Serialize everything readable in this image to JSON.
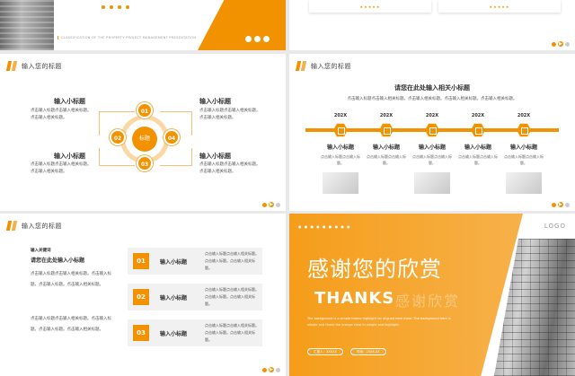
{
  "header_title": "输入您的标题",
  "slide1": {
    "subtitle": "CLASSIFICATION OF THE PROPERTY PROJECT MANAGEMENT PRESENTATION"
  },
  "slide3": {
    "center": "标题",
    "circles": [
      "01",
      "02",
      "03",
      "04"
    ],
    "blocks": [
      {
        "title": "输入小标题",
        "text": "点击输入标题点击输入相关标题。点击输入相关标题。"
      },
      {
        "title": "输入小标题",
        "text": "点击输入标题点击输入相关标题。点击输入相关标题。"
      },
      {
        "title": "输入小标题",
        "text": "点击输入标题点击输入相关标题。点击输入相关标题。"
      },
      {
        "title": "输入小标题",
        "text": "点击输入标题点击输入相关标题。点击输入相关标题。"
      }
    ]
  },
  "slide4": {
    "title": "请您在此处输入相关小标题",
    "subtitle": "点击输入标题点击输入相关标题。点击输入相关标题。点击输入相关标题。点击输入相关标题。",
    "items": [
      {
        "year": "202X",
        "title": "输入小标题",
        "text": "点击输入标题点击输入标题。"
      },
      {
        "year": "202X",
        "title": "输入小标题",
        "text": "点击输入标题点击输入标题。"
      },
      {
        "year": "202X",
        "title": "输入小标题",
        "text": "点击输入标题点击输入标题。"
      },
      {
        "year": "202X",
        "title": "输入小标题",
        "text": "点击输入标题点击输入标题。"
      },
      {
        "year": "202X",
        "title": "输入小标题",
        "text": "点击输入标题点击输入标题。"
      }
    ]
  },
  "slide5": {
    "keyword": "输入关键词",
    "heading": "请您在此处输入小标题",
    "paras": [
      "点击输入标题点击输入相关标题。点击输入标题。点击输入标题。点击输入相关标题。",
      "点击输入标题点击输入相关标题。点击输入标题。点击输入标题。点击输入相关标题。"
    ],
    "rows": [
      {
        "num": "01",
        "title": "输入小标题",
        "text": "点击输入标题点击输入相关标题。点击输入标题。点击输入相关标题。"
      },
      {
        "num": "02",
        "title": "输入小标题",
        "text": "点击输入标题点击输入相关标题。点击输入标题。点击输入相关标题。"
      },
      {
        "num": "03",
        "title": "输入小标题",
        "text": "点击输入标题点击输入相关标题。点击输入标题。点击输入相关标题。"
      }
    ]
  },
  "slide6": {
    "logo": "LOGO",
    "main_title": "感谢您的欣赏",
    "thanks": "THANKS",
    "ghost": "感谢欣赏",
    "small_text": "The background is a simple theme highlight for aligned here more. The background here is simple and thank the orange clear in simple and highlight.",
    "pill1": "汇报人：XXXXX",
    "pill2": "时间：20XX.XX"
  }
}
